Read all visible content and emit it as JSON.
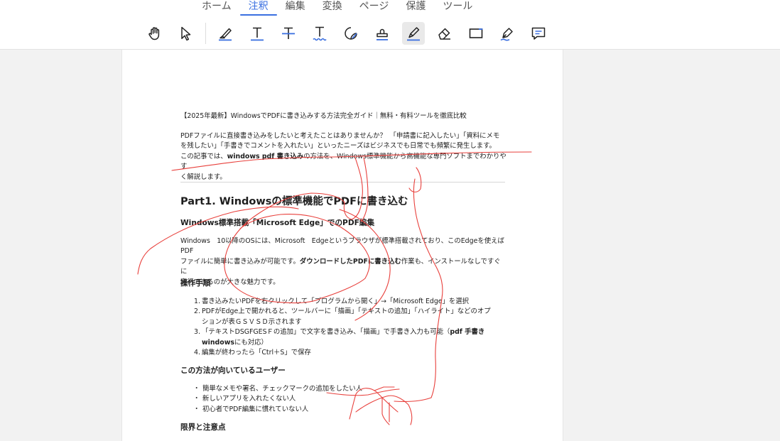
{
  "menu": {
    "tabs": [
      {
        "label": "ホーム"
      },
      {
        "label": "注釈"
      },
      {
        "label": "編集"
      },
      {
        "label": "変換"
      },
      {
        "label": "ページ"
      },
      {
        "label": "保護"
      },
      {
        "label": "ツール"
      }
    ],
    "active_tab": "注釈"
  },
  "toolbar": {
    "tools": [
      "hand-icon",
      "select-arrow-icon",
      "highlight-icon",
      "underline-text-icon",
      "strikethrough-text-icon",
      "squiggly-text-icon",
      "sticky-note-icon",
      "stamp-icon",
      "freehand-draw-icon",
      "eraser-icon",
      "rectangle-icon",
      "pen-tool-icon",
      "comment-icon"
    ],
    "active_tool": "freehand-draw-icon"
  },
  "document": {
    "title": "【2025年最新】WindowsでPDFに書き込みする方法完全ガイド｜無料・有料ツールを徹底比較",
    "intro_line1": "PDFファイルに直接書き込みをしたいと考えたことはありませんか？　「申請書に記入したい」「資料にメモ",
    "intro_line2": "を残したい」「手書きでコメントを入れたい」といったニーズはビジネスでも日常でも頻繁に発生します。",
    "intro_line3_pre": "この記事では、",
    "intro_line3_bold": "windows pdf 書き込み",
    "intro_line3_post": "の方法を、Windows標準機能から高機能な専門ソフトまでわかりやす",
    "intro_line4": "く解説します。",
    "part1_heading": "Part1. Windowsの標準機能でPDFに書き込む",
    "edge_heading": "Windows標準搭載「Microsoft Edge」でのPDF編集",
    "edge_line1": "Windows　10以降のOSには、Microsoft　Edgeというブラウザが標準搭載されており、このEdgeを使えばPDF",
    "edge_line2_pre": "ファイルに簡単に書き込みが可能です。",
    "edge_line2_bold": "ダウンロードしたPDFに書き込む",
    "edge_line2_post": "作業も、インストールなしですぐに",
    "edge_line3": "実行できるのが大きな魅力です。",
    "steps_heading": "操作手順",
    "steps": [
      {
        "num": "1.",
        "line1": "書き込みたいPDFを右クリックして「プログラムから開く」→「Microsoft Edge」を選択"
      },
      {
        "num": "2.",
        "line1": "PDFがEdge上で開かれると、ツールバーに「描画」「テキストの追加」「ハイライト」などのオプ",
        "line2": "ションが表ＧＳＶＳＤ示されます"
      },
      {
        "num": "3.",
        "line1_pre": "「テキストDSGFGESＦの追加」で文字を書き込み、「描画」で手書き入力も可能（",
        "line1_bold": "pdf 手書き",
        "line2_bold": "windows",
        "line2_post": "にも対応）"
      },
      {
        "num": "4.",
        "line1": "編集が終わったら「Ctrl＋S」で保存"
      }
    ],
    "users_heading": "この方法が向いているユーザー",
    "bullet": "・",
    "users": [
      "簡単なメモや署名、チェックマークの追加をしたい人",
      "新しいアプリを入れたくない人",
      "初心者でPDF編集に慣れていない人"
    ],
    "limits_heading": "限界と注意点"
  },
  "colors": {
    "accent": "#3a6fe0",
    "ink": "#e8403c",
    "page_bg": "#ffffff",
    "canvas_bg": "#f2f2f2"
  }
}
